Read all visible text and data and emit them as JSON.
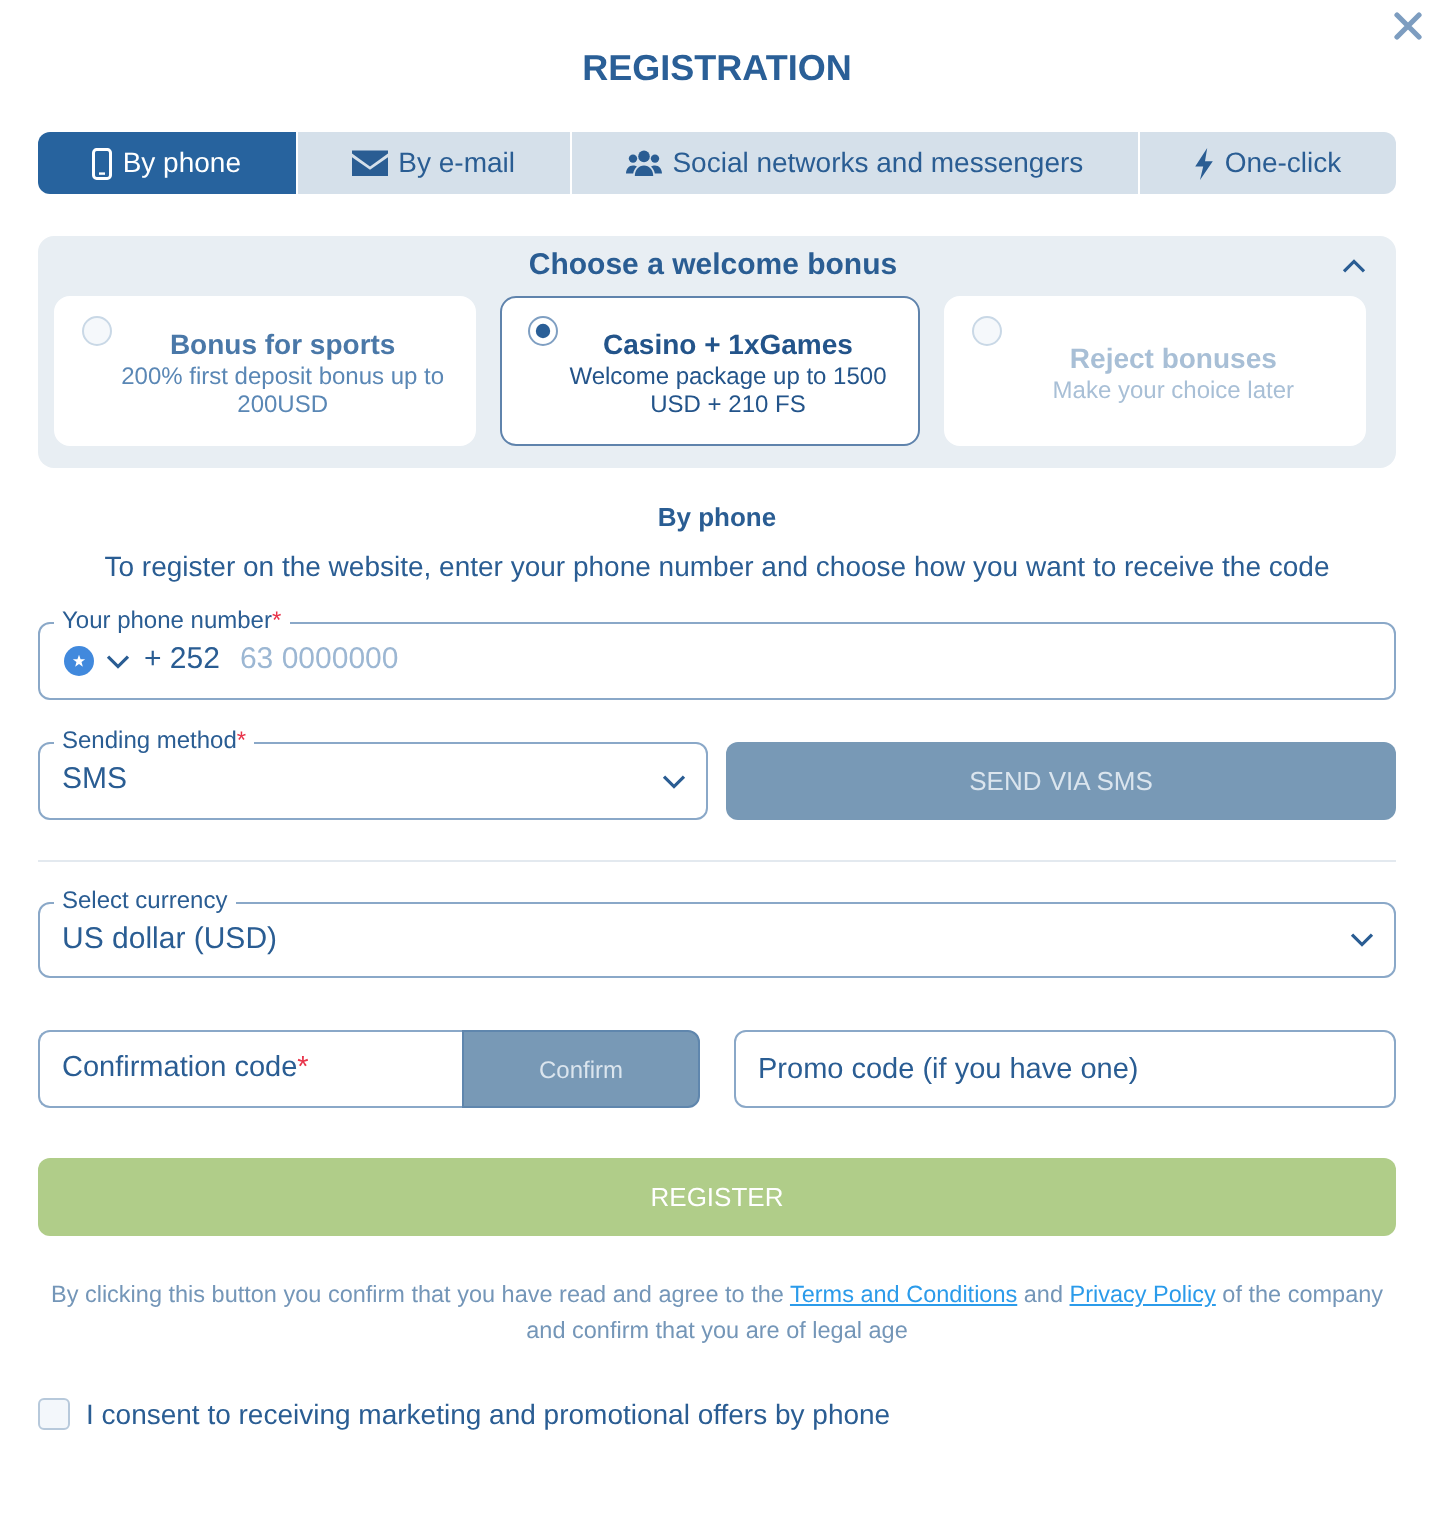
{
  "window": {
    "title": "REGISTRATION"
  },
  "tabs": [
    {
      "label": "By phone",
      "selected": true
    },
    {
      "label": "By e-mail",
      "selected": false
    },
    {
      "label": "Social networks and messengers",
      "selected": false
    },
    {
      "label": "One-click",
      "selected": false
    }
  ],
  "bonus": {
    "title": "Choose a welcome bonus",
    "expanded": true,
    "options": [
      {
        "kind": "offer",
        "title": "Bonus for sports",
        "description": "200% first deposit bonus up to 200USD",
        "selected": false
      },
      {
        "kind": "offer",
        "title": "Casino + 1xGames",
        "description": "Welcome package up to 1500 USD + 210 FS",
        "selected": true
      },
      {
        "kind": "reject",
        "title": "Reject bonuses",
        "description": "Make your choice later",
        "selected": false
      }
    ]
  },
  "form": {
    "heading": "By phone",
    "intro": "To register on the website, enter your phone number and choose how you want to receive the code",
    "phone": {
      "label": "Your phone number",
      "required_mark": "*",
      "dial_code": "+ 252",
      "placeholder": "63 0000000"
    },
    "sending_method": {
      "label": "Sending method",
      "required_mark": "*",
      "value": "SMS"
    },
    "send_button": {
      "label": "SEND VIA SMS",
      "disabled": true
    },
    "currency": {
      "label": "Select currency",
      "value": "US dollar (USD)"
    },
    "confirmation_code": {
      "placeholder": "Confirmation code",
      "required_mark": "*",
      "button": {
        "label": "Confirm",
        "disabled": true
      }
    },
    "promo_code": {
      "placeholder": "Promo code (if you have one)"
    },
    "register_button": {
      "label": "REGISTER",
      "disabled": true
    },
    "terms": [
      {
        "kind": "text",
        "text": "By clicking this button you confirm that you have read and agree to the"
      },
      {
        "kind": "link",
        "text": "Terms and Conditions"
      },
      {
        "kind": "text",
        "text": "and"
      },
      {
        "kind": "link",
        "text": "Privacy Policy"
      },
      {
        "kind": "text",
        "text": "of the company and confirm that you are of legal age"
      }
    ],
    "consent": {
      "label": "I consent to receiving marketing and promotional offers by phone",
      "checked": false
    }
  }
}
